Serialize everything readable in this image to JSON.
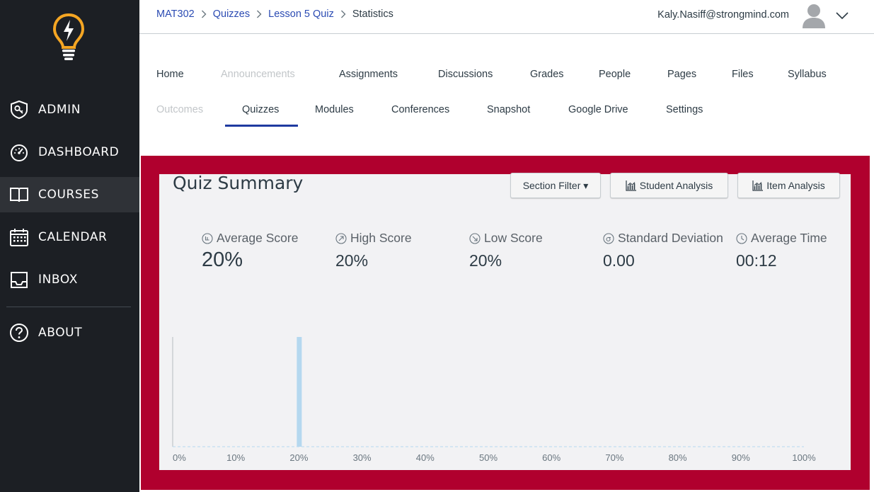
{
  "sidebar": {
    "items": [
      {
        "label": "ADMIN",
        "icon": "shield-icon"
      },
      {
        "label": "DASHBOARD",
        "icon": "dashboard-icon"
      },
      {
        "label": "COURSES",
        "icon": "book-icon"
      },
      {
        "label": "CALENDAR",
        "icon": "calendar-icon"
      },
      {
        "label": "INBOX",
        "icon": "inbox-icon"
      },
      {
        "label": "ABOUT",
        "icon": "question-icon"
      }
    ],
    "active_index": 2
  },
  "header": {
    "breadcrumb": [
      "MAT302",
      "Quizzes",
      "Lesson 5 Quiz",
      "Statistics"
    ],
    "user_email": "Kaly.Nasiff@strongmind.com"
  },
  "tabs": {
    "row1": [
      "Home",
      "Announcements",
      "Assignments",
      "Discussions",
      "Grades",
      "People",
      "Pages",
      "Files",
      "Syllabus"
    ],
    "row2": [
      "Outcomes",
      "Quizzes",
      "Modules",
      "Conferences",
      "Snapshot",
      "Google Drive",
      "Settings"
    ],
    "active": "Quizzes",
    "disabled": [
      "Announcements",
      "Outcomes"
    ]
  },
  "summary": {
    "title": "Quiz Summary",
    "section_filter_label": "Section Filter ▾",
    "student_analysis_label": "Student Analysis",
    "item_analysis_label": "Item Analysis",
    "stats": [
      {
        "label": "Average Score",
        "value": "20%",
        "icon": "dashboard-circle-icon"
      },
      {
        "label": "High Score",
        "value": "20%",
        "icon": "arrow-up-right-circle-icon"
      },
      {
        "label": "Low Score",
        "value": "20%",
        "icon": "arrow-down-right-circle-icon"
      },
      {
        "label": "Standard Deviation",
        "value": "0.00",
        "icon": "sigma-circle-icon"
      },
      {
        "label": "Average Time",
        "value": "00:12",
        "icon": "clock-icon"
      }
    ]
  },
  "colors": {
    "panel_red": "#b0002e",
    "bar_blue": "#b5d8ef",
    "link_blue": "#2b4bb3",
    "sidebar_bg": "#1c1f24",
    "logo_orange": "#f5a623"
  },
  "chart_data": {
    "type": "bar",
    "x_ticks": [
      "0%",
      "10%",
      "20%",
      "30%",
      "40%",
      "50%",
      "60%",
      "70%",
      "80%",
      "90%",
      "100%"
    ],
    "x": [
      20
    ],
    "values": [
      1
    ],
    "xlim": [
      0,
      100
    ],
    "grid": false
  }
}
